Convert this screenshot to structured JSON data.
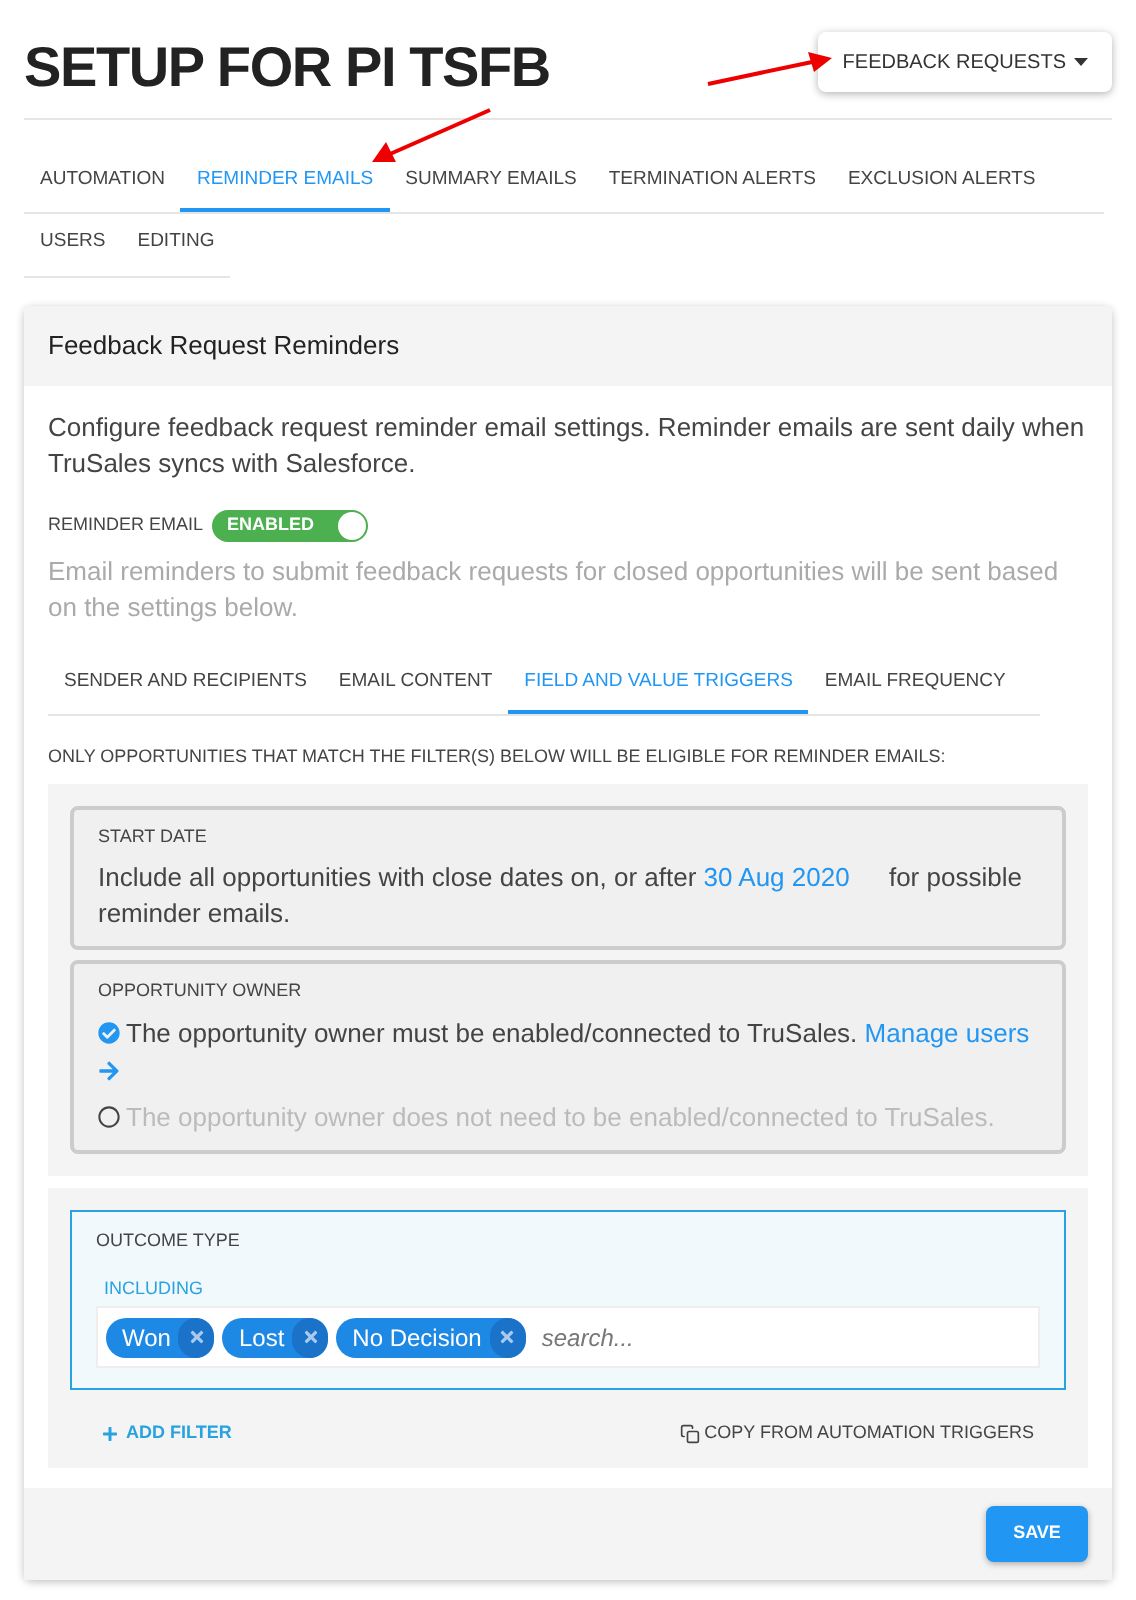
{
  "page_title": "SETUP FOR PI TSFB",
  "menu_button": {
    "label": "FEEDBACK REQUESTS"
  },
  "tabs": [
    {
      "label": "AUTOMATION",
      "selected": false
    },
    {
      "label": "REMINDER EMAILS",
      "selected": true
    },
    {
      "label": "SUMMARY EMAILS",
      "selected": false
    },
    {
      "label": "TERMINATION ALERTS",
      "selected": false
    },
    {
      "label": "EXCLUSION ALERTS",
      "selected": false
    },
    {
      "label": "USERS",
      "selected": false
    },
    {
      "label": "EDITING",
      "selected": false
    }
  ],
  "card": {
    "title": "Feedback Request Reminders",
    "description": "Configure feedback request reminder email settings. Reminder emails are sent daily when TruSales syncs with Salesforce.",
    "toggle": {
      "label": "REMINDER EMAIL",
      "state_text": "ENABLED",
      "on": true
    },
    "toggle_note": "Email reminders to submit feedback requests for closed opportunities will be sent based on the settings below.",
    "subtabs": [
      {
        "label": "SENDER AND RECIPIENTS",
        "selected": false
      },
      {
        "label": "EMAIL CONTENT",
        "selected": false
      },
      {
        "label": "FIELD AND VALUE TRIGGERS",
        "selected": true
      },
      {
        "label": "EMAIL FREQUENCY",
        "selected": false
      }
    ],
    "filter_note": "ONLY OPPORTUNITIES THAT MATCH THE FILTER(S) BELOW WILL BE ELIGIBLE FOR REMINDER EMAILS:",
    "start_date": {
      "heading": "START DATE",
      "text_before": "Include all opportunities with close dates on, or after",
      "date": "30 Aug 2020",
      "text_after": "for possible reminder emails."
    },
    "owner": {
      "heading": "OPPORTUNITY OWNER",
      "options": [
        {
          "label": "The opportunity owner must be enabled/connected to TruSales.",
          "link": "Manage users",
          "selected": true
        },
        {
          "label": "The opportunity owner does not need to be enabled/connected to TruSales.",
          "selected": false
        }
      ]
    },
    "outcome": {
      "heading": "OUTCOME TYPE",
      "mode": "INCLUDING",
      "tags": [
        "Won",
        "Lost",
        "No Decision"
      ],
      "placeholder": "search..."
    },
    "add_filter": "ADD FILTER",
    "copy_link": "COPY FROM AUTOMATION TRIGGERS",
    "save": "SAVE"
  }
}
